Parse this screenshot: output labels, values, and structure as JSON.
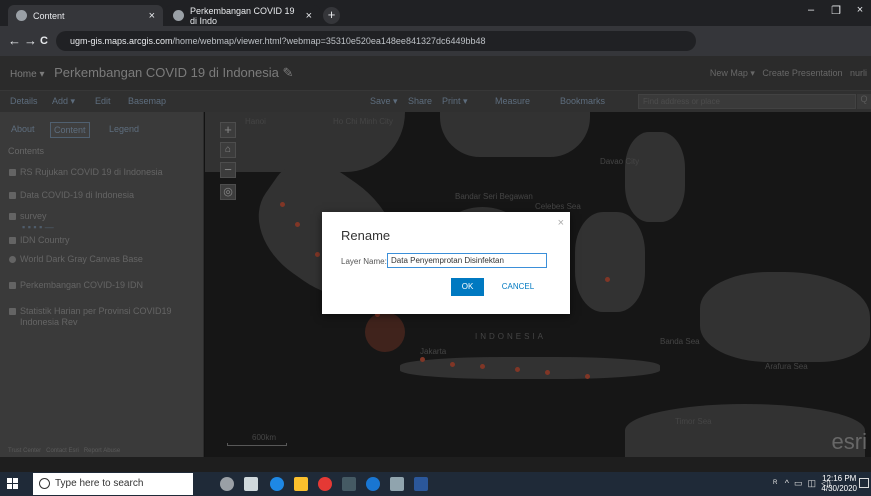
{
  "browser": {
    "tabs": [
      {
        "title": "Content",
        "close": "×"
      },
      {
        "title": "Perkembangan COVID 19 di Indo",
        "close": "×"
      }
    ],
    "new_tab": "+",
    "window_controls": [
      "–",
      "❐",
      "×"
    ],
    "nav": {
      "back": "←",
      "forward": "→",
      "reload": "C"
    },
    "url": {
      "domain": "ugm-gis.maps.arcgis.com",
      "path": "/home/webmap/viewer.html?webmap=35310e520ea148ee841327dc6449bb48"
    }
  },
  "arcgis": {
    "header": {
      "home": "Home ▾",
      "title": "Perkembangan COVID 19 di Indonesia",
      "edit_icon": "✎",
      "new_map": "New Map ▾",
      "create_presentation": "Create Presentation",
      "user": "nurli"
    },
    "toolbar": {
      "details": "Details",
      "add": "Add ▾",
      "edit": "Edit",
      "basemap": "Basemap",
      "save": "Save ▾",
      "share": "Share",
      "print": "Print ▾",
      "measure": "Measure",
      "bookmarks": "Bookmarks",
      "find_placeholder": "Find address or place",
      "find_icon": "Q"
    },
    "sidebar": {
      "tabs": {
        "about": "About",
        "content": "Content",
        "legend": "Legend"
      },
      "heading": "Contents",
      "layers": [
        "RS Rujukan COVID 19 di Indonesia",
        "Data COVID-19 di Indonesia",
        "survey",
        "IDN Country",
        "World Dark Gray Canvas Base",
        "Perkembangan COVID-19 IDN",
        "Statistik Harian per Provinsi COVID19",
        "Indonesia Rev"
      ],
      "footer": [
        "Trust Center",
        "Contact Esri",
        "Report Abuse"
      ]
    },
    "map": {
      "zoom_in": "+",
      "home": "⌂",
      "zoom_out": "−",
      "locate": "◎",
      "labels": [
        "Hanoi",
        "Ho Chi Minh City",
        "Davao City",
        "Bandar Seri Begawan",
        "Celebes Sea",
        "INDONESIA",
        "Jakarta",
        "Banda Sea",
        "Arafura Sea",
        "Timor Sea"
      ],
      "scale_label": "600km",
      "esri": "esri"
    }
  },
  "dialog": {
    "title": "Rename",
    "close": "×",
    "label": "Layer Name:",
    "value": "Data Penyemprotan Disinfektan",
    "ok": "OK",
    "cancel": "CANCEL"
  },
  "taskbar": {
    "search_placeholder": "Type here to search",
    "time": "12:16 PM",
    "date": "4/30/2020"
  }
}
